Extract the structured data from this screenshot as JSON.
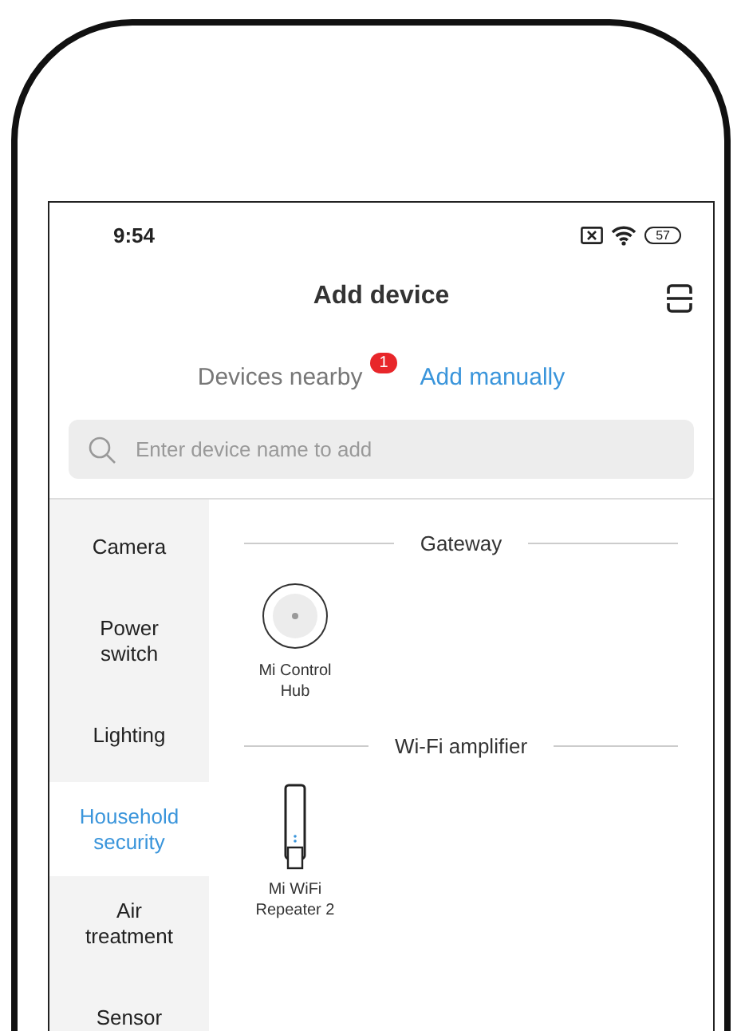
{
  "status_bar": {
    "time": "9:54",
    "battery": "57"
  },
  "header": {
    "title": "Add device"
  },
  "tabs": [
    {
      "label": "Devices nearby",
      "badge": "1",
      "selected": false
    },
    {
      "label": "Add manually",
      "selected": true
    }
  ],
  "search": {
    "placeholder": "Enter device name to add"
  },
  "categories": [
    {
      "label": "Camera",
      "selected": false
    },
    {
      "label": "Power switch",
      "selected": false
    },
    {
      "label": "Lighting",
      "selected": false
    },
    {
      "label": "Household security",
      "selected": true
    },
    {
      "label": "Air treatment",
      "selected": false
    },
    {
      "label": "Sensor",
      "selected": false
    }
  ],
  "sections": [
    {
      "title": "Gateway",
      "devices": [
        {
          "name": "Mi Control Hub",
          "kind": "hub"
        }
      ]
    },
    {
      "title": "Wi-Fi amplifier",
      "devices": [
        {
          "name": "Mi WiFi Repeater 2",
          "kind": "repeater"
        }
      ]
    }
  ]
}
